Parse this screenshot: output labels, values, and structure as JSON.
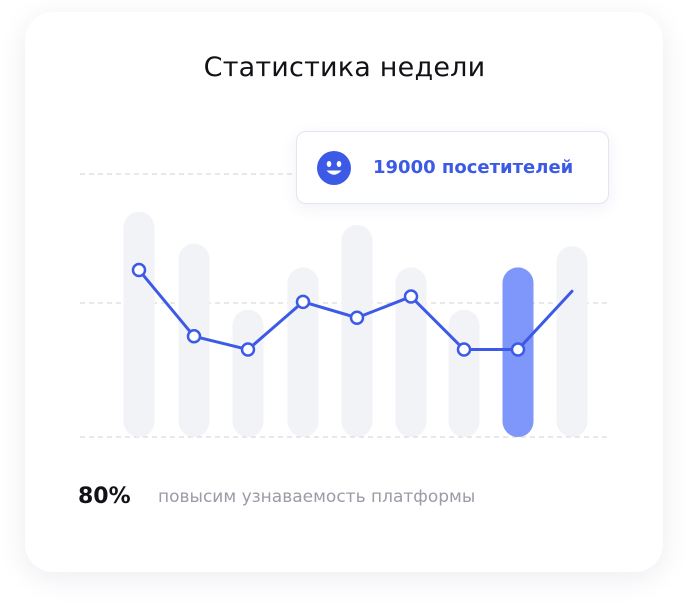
{
  "card": {
    "title": "Статистика недели"
  },
  "tooltip": {
    "icon": "smiley-icon",
    "text": "19000 посетителей"
  },
  "stat": {
    "value": "80%",
    "label": "повысим узнаваемость платформы"
  },
  "colors": {
    "accent": "#3c5ae6",
    "bar": "#f2f3f6",
    "bar_highlight": "#7f97fb",
    "grid": "#cfd1d8"
  },
  "chart_data": {
    "type": "line",
    "grid": "dashed horizontal",
    "series": [
      {
        "values": [
          6.3,
          3.8,
          3.3,
          5.1,
          4.5,
          5.3,
          3.3,
          3.3,
          5.5
        ]
      }
    ],
    "bars": {
      "values": [
        8.5,
        7.3,
        4.8,
        6.4,
        8.0,
        6.4,
        4.8,
        6.4,
        7.2
      ],
      "highlight_index": 7
    },
    "ylim": [
      0,
      10
    ]
  }
}
